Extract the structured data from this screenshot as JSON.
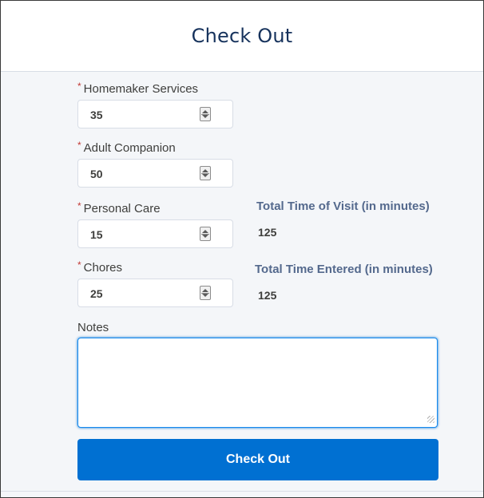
{
  "header": {
    "title": "Check Out"
  },
  "form": {
    "required_marker": "*",
    "fields": [
      {
        "label": "Homemaker Services",
        "value": "35"
      },
      {
        "label": "Adult Companion",
        "value": "50"
      },
      {
        "label": "Personal Care",
        "value": "15"
      },
      {
        "label": "Chores",
        "value": "25"
      }
    ],
    "notes": {
      "label": "Notes",
      "value": ""
    }
  },
  "summary": {
    "total_visit_label": "Total Time of Visit (in minutes)",
    "total_visit_value": "125",
    "total_entered_label": "Total Time Entered (in minutes)",
    "total_entered_value": "125"
  },
  "actions": {
    "checkout_label": "Check Out"
  },
  "colors": {
    "primary_button": "#0070d2",
    "required_asterisk": "#c23934",
    "title_text": "#16325c",
    "summary_label": "#54698d"
  },
  "icons": {
    "stepper": "spinner-arrows-icon",
    "resize": "resize-grip-icon"
  }
}
